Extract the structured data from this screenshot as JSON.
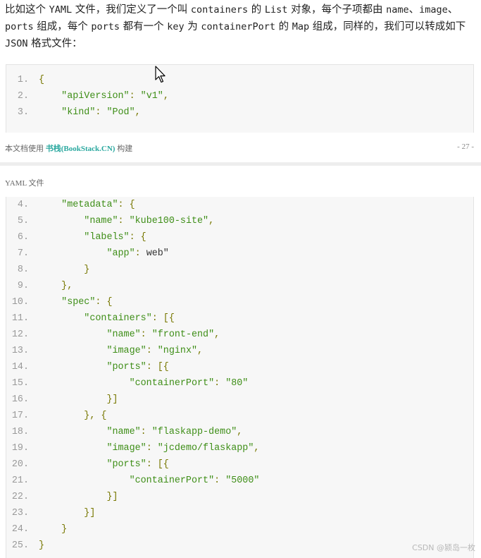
{
  "intro": {
    "segments": [
      {
        "t": "比如这个 ",
        "code": false
      },
      {
        "t": "YAML",
        "code": true
      },
      {
        "t": " 文件，我们定义了一个叫 ",
        "code": false
      },
      {
        "t": "containers",
        "code": true
      },
      {
        "t": " 的 ",
        "code": false
      },
      {
        "t": "List",
        "code": true
      },
      {
        "t": " 对象，每个子项都由 ",
        "code": false
      },
      {
        "t": "name",
        "code": true
      },
      {
        "t": "、",
        "code": false
      },
      {
        "t": "image",
        "code": true
      },
      {
        "t": "、",
        "code": false
      },
      {
        "t": "ports",
        "code": true
      },
      {
        "t": " 组成，每个 ",
        "code": false
      },
      {
        "t": "ports",
        "code": true
      },
      {
        "t": " 都有一个 ",
        "code": false
      },
      {
        "t": "key",
        "code": true
      },
      {
        "t": " 为 ",
        "code": false
      },
      {
        "t": "containerPort",
        "code": true
      },
      {
        "t": " 的 ",
        "code": false
      },
      {
        "t": "Map",
        "code": true
      },
      {
        "t": " 组成，同样的，我们可以转成如下 ",
        "code": false
      },
      {
        "t": "JSON",
        "code": true
      },
      {
        "t": " 格式文件：",
        "code": false
      }
    ]
  },
  "code_top": [
    {
      "n": "1.",
      "tokens": [
        [
          "pun",
          "{"
        ]
      ]
    },
    {
      "n": "2.",
      "tokens": [
        [
          "plain",
          "    "
        ],
        [
          "key",
          "\"apiVersion\""
        ],
        [
          "pun",
          ": "
        ],
        [
          "str",
          "\"v1\""
        ],
        [
          "pun",
          ","
        ]
      ]
    },
    {
      "n": "3.",
      "tokens": [
        [
          "plain",
          "    "
        ],
        [
          "key",
          "\"kind\""
        ],
        [
          "pun",
          ": "
        ],
        [
          "str",
          "\"Pod\""
        ],
        [
          "pun",
          ","
        ]
      ]
    }
  ],
  "footer": {
    "prefix": "本文档使用 ",
    "brand": "书栈(BookStack.CN)",
    "suffix": " 构建",
    "page": "- 27 -"
  },
  "page_header": "YAML 文件",
  "code_bottom": [
    {
      "n": "4.",
      "tokens": [
        [
          "plain",
          "    "
        ],
        [
          "key",
          "\"metadata\""
        ],
        [
          "pun",
          ": {"
        ]
      ]
    },
    {
      "n": "5.",
      "tokens": [
        [
          "plain",
          "        "
        ],
        [
          "key",
          "\"name\""
        ],
        [
          "pun",
          ": "
        ],
        [
          "str",
          "\"kube100-site\""
        ],
        [
          "pun",
          ","
        ]
      ]
    },
    {
      "n": "6.",
      "tokens": [
        [
          "plain",
          "        "
        ],
        [
          "key",
          "\"labels\""
        ],
        [
          "pun",
          ": {"
        ]
      ]
    },
    {
      "n": "7.",
      "tokens": [
        [
          "plain",
          "            "
        ],
        [
          "key",
          "\"app\""
        ],
        [
          "pun",
          ": "
        ],
        [
          "plain",
          "web\""
        ]
      ]
    },
    {
      "n": "8.",
      "tokens": [
        [
          "plain",
          "        "
        ],
        [
          "pun",
          "}"
        ]
      ]
    },
    {
      "n": "9.",
      "tokens": [
        [
          "plain",
          "    "
        ],
        [
          "pun",
          "},"
        ]
      ]
    },
    {
      "n": "10.",
      "tokens": [
        [
          "plain",
          "    "
        ],
        [
          "key",
          "\"spec\""
        ],
        [
          "pun",
          ": {"
        ]
      ]
    },
    {
      "n": "11.",
      "tokens": [
        [
          "plain",
          "        "
        ],
        [
          "key",
          "\"containers\""
        ],
        [
          "pun",
          ": [{"
        ]
      ]
    },
    {
      "n": "12.",
      "tokens": [
        [
          "plain",
          "            "
        ],
        [
          "key",
          "\"name\""
        ],
        [
          "pun",
          ": "
        ],
        [
          "str",
          "\"front-end\""
        ],
        [
          "pun",
          ","
        ]
      ]
    },
    {
      "n": "13.",
      "tokens": [
        [
          "plain",
          "            "
        ],
        [
          "key",
          "\"image\""
        ],
        [
          "pun",
          ": "
        ],
        [
          "str",
          "\"nginx\""
        ],
        [
          "pun",
          ","
        ]
      ]
    },
    {
      "n": "14.",
      "tokens": [
        [
          "plain",
          "            "
        ],
        [
          "key",
          "\"ports\""
        ],
        [
          "pun",
          ": [{"
        ]
      ]
    },
    {
      "n": "15.",
      "tokens": [
        [
          "plain",
          "                "
        ],
        [
          "key",
          "\"containerPort\""
        ],
        [
          "pun",
          ": "
        ],
        [
          "str",
          "\"80\""
        ]
      ]
    },
    {
      "n": "16.",
      "tokens": [
        [
          "plain",
          "            "
        ],
        [
          "pun",
          "}]"
        ]
      ]
    },
    {
      "n": "17.",
      "tokens": [
        [
          "plain",
          "        "
        ],
        [
          "pun",
          "}, {"
        ]
      ]
    },
    {
      "n": "18.",
      "tokens": [
        [
          "plain",
          "            "
        ],
        [
          "key",
          "\"name\""
        ],
        [
          "pun",
          ": "
        ],
        [
          "str",
          "\"flaskapp-demo\""
        ],
        [
          "pun",
          ","
        ]
      ]
    },
    {
      "n": "19.",
      "tokens": [
        [
          "plain",
          "            "
        ],
        [
          "key",
          "\"image\""
        ],
        [
          "pun",
          ": "
        ],
        [
          "str",
          "\"jcdemo/flaskapp\""
        ],
        [
          "pun",
          ","
        ]
      ]
    },
    {
      "n": "20.",
      "tokens": [
        [
          "plain",
          "            "
        ],
        [
          "key",
          "\"ports\""
        ],
        [
          "pun",
          ": [{"
        ]
      ]
    },
    {
      "n": "21.",
      "tokens": [
        [
          "plain",
          "                "
        ],
        [
          "key",
          "\"containerPort\""
        ],
        [
          "pun",
          ": "
        ],
        [
          "str",
          "\"5000\""
        ]
      ]
    },
    {
      "n": "22.",
      "tokens": [
        [
          "plain",
          "            "
        ],
        [
          "pun",
          "}]"
        ]
      ]
    },
    {
      "n": "23.",
      "tokens": [
        [
          "plain",
          "        "
        ],
        [
          "pun",
          "}]"
        ]
      ]
    },
    {
      "n": "24.",
      "tokens": [
        [
          "plain",
          "    "
        ],
        [
          "pun",
          "}"
        ]
      ]
    },
    {
      "n": "25.",
      "tokens": [
        [
          "pun",
          "}"
        ]
      ]
    }
  ],
  "watermark": "CSDN @颍岛一枚"
}
